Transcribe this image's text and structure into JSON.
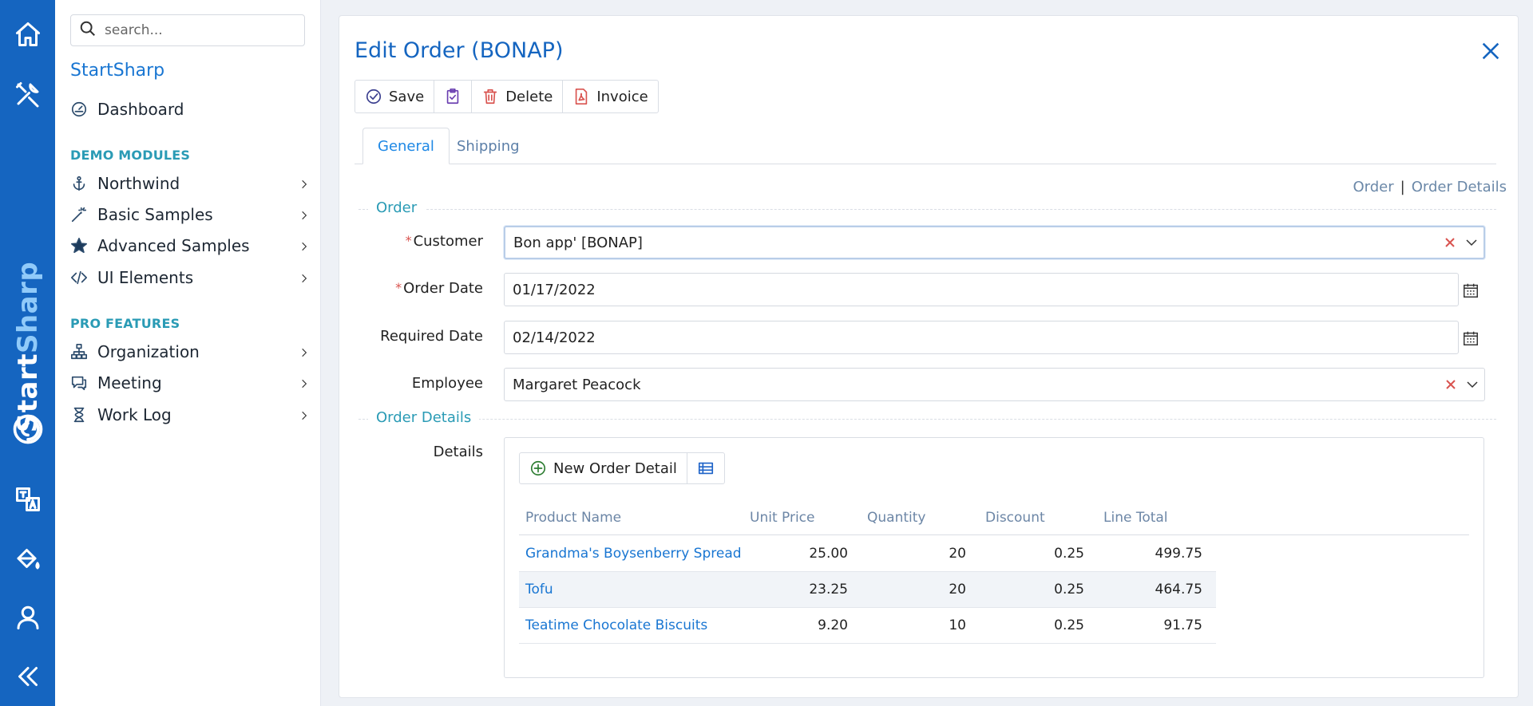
{
  "rail": {
    "brand_part1": "Start",
    "brand_part2": "Sharp",
    "icons": [
      "home-icon",
      "tools-icon",
      "translate-icon",
      "theme-icon",
      "user-icon",
      "collapse-icon"
    ]
  },
  "sidebar": {
    "search_placeholder": "search...",
    "app_title": "StartSharp",
    "dashboard": "Dashboard",
    "section_demo": "DEMO MODULES",
    "demo_items": [
      {
        "label": "Northwind",
        "icon": "anchor-icon"
      },
      {
        "label": "Basic Samples",
        "icon": "wand-icon"
      },
      {
        "label": "Advanced Samples",
        "icon": "star-icon"
      },
      {
        "label": "UI Elements",
        "icon": "code-icon"
      }
    ],
    "section_pro": "PRO FEATURES",
    "pro_items": [
      {
        "label": "Organization",
        "icon": "org-chart-icon"
      },
      {
        "label": "Meeting",
        "icon": "chat-icon"
      },
      {
        "label": "Work Log",
        "icon": "hourglass-icon"
      }
    ]
  },
  "dialog": {
    "title": "Edit Order (BONAP)",
    "toolbar": {
      "save": "Save",
      "delete": "Delete",
      "invoice": "Invoice"
    },
    "tabs": [
      "General",
      "Shipping"
    ],
    "anchors": {
      "order": "Order",
      "sep": "|",
      "order_details": "Order Details"
    },
    "sections": {
      "order": "Order",
      "order_details": "Order Details"
    },
    "fields": {
      "customer_label": "Customer",
      "customer_value": "Bon app' [BONAP]",
      "order_date_label": "Order Date",
      "order_date_value": "01/17/2022",
      "required_date_label": "Required Date",
      "required_date_value": "02/14/2022",
      "employee_label": "Employee",
      "employee_value": "Margaret Peacock",
      "details_label": "Details",
      "required_marker": "*"
    },
    "details": {
      "new_button": "New Order Detail",
      "columns": [
        "Product Name",
        "Unit Price",
        "Quantity",
        "Discount",
        "Line Total"
      ],
      "rows": [
        {
          "product": "Grandma's Boysenberry Spread",
          "unit_price": "25.00",
          "quantity": "20",
          "discount": "0.25",
          "line_total": "499.75"
        },
        {
          "product": "Tofu",
          "unit_price": "23.25",
          "quantity": "20",
          "discount": "0.25",
          "line_total": "464.75"
        },
        {
          "product": "Teatime Chocolate Biscuits",
          "unit_price": "9.20",
          "quantity": "10",
          "discount": "0.25",
          "line_total": "91.75"
        }
      ]
    }
  },
  "colors": {
    "rail": "#1565c0",
    "accent": "#1976d2",
    "section": "#2a9bb5",
    "required": "#d9534f"
  }
}
